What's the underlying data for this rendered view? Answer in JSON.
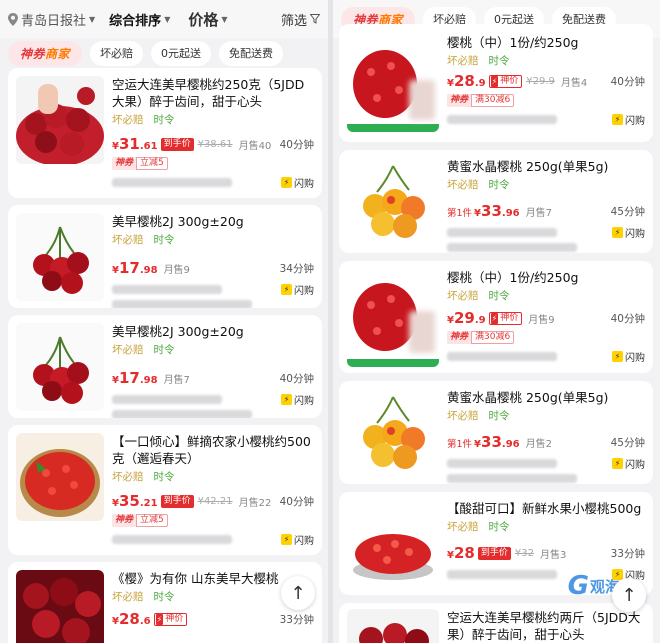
{
  "left_header": {
    "location": "青岛日报社",
    "sort": "综合排序",
    "price": "价格",
    "filter": "筛选"
  },
  "chips": {
    "brand_a": "神券",
    "brand_b": "商家",
    "no_bad": "坏必赔",
    "zero_start": "0元起送",
    "free_delivery": "免配送费"
  },
  "left_cards": [
    {
      "title": "空运大连美早樱桃约250克（5JDD大果）醉于齿间，甜于心头",
      "tag1": "坏必赔",
      "tag2": "时令",
      "price_int": "31",
      "price_dec": ".61",
      "badge": "到手价",
      "orig": "¥38.61",
      "sold": "月售40",
      "eta": "40分钟",
      "promo1": "神券",
      "promo2": "立减5",
      "flash": "闪购"
    },
    {
      "title": "美早樱桃2J 300g±20g",
      "tag1": "坏必赔",
      "tag2": "时令",
      "price_int": "17",
      "price_dec": ".98",
      "sold": "月售9",
      "eta": "34分钟",
      "flash": "闪购"
    },
    {
      "title": "美早樱桃2J 300g±20g",
      "tag1": "坏必赔",
      "tag2": "时令",
      "price_int": "17",
      "price_dec": ".98",
      "sold": "月售7",
      "eta": "40分钟",
      "flash": "闪购"
    },
    {
      "title": "【一口倾心】鲜摘农家小樱桃约500克（邂逅春天）",
      "tag1": "坏必赔",
      "tag2": "时令",
      "price_int": "35",
      "price_dec": ".21",
      "badge": "到手价",
      "orig": "¥42.21",
      "sold": "月售22",
      "eta": "40分钟",
      "promo1": "神券",
      "promo2": "立减5",
      "flash": "闪购"
    },
    {
      "title": "《樱》为有你 山东美早大樱桃",
      "tag1": "坏必赔",
      "tag2": "时令",
      "price_int": "28",
      "price_dec": ".6",
      "badge": "神价",
      "eta": "33分钟"
    }
  ],
  "right_cards": [
    {
      "title": "樱桃（中）1份/约250g",
      "tag1": "坏必赔",
      "tag2": "时令",
      "price_int": "28",
      "price_dec": ".9",
      "badge": "神价",
      "orig": "¥29.9",
      "sold": "月售4",
      "eta": "40分钟",
      "promo1": "神券",
      "promo2": "满30减6",
      "flash": "闪购"
    },
    {
      "title": "黄蜜水晶樱桃 250g(单果5g)",
      "tag1": "坏必赔",
      "tag2": "时令",
      "first": "第1件",
      "price_int": "33",
      "price_dec": ".96",
      "sold": "月售7",
      "eta": "45分钟",
      "flash": "闪购"
    },
    {
      "title": "樱桃（中）1份/约250g",
      "tag1": "坏必赔",
      "tag2": "时令",
      "price_int": "29",
      "price_dec": ".9",
      "badge": "神价",
      "sold": "月售9",
      "eta": "40分钟",
      "promo1": "神券",
      "promo2": "满30减6",
      "flash": "闪购"
    },
    {
      "title": "黄蜜水晶樱桃 250g(单果5g)",
      "tag1": "坏必赔",
      "tag2": "时令",
      "first": "第1件",
      "price_int": "33",
      "price_dec": ".96",
      "sold": "月售2",
      "eta": "45分钟",
      "flash": "闪购"
    },
    {
      "title": "【酸甜可口】新鲜水果小樱桃500g",
      "tag1": "坏必赔",
      "tag2": "时令",
      "price_int": "28",
      "price_dec": "",
      "badge": "到手价",
      "orig": "¥32",
      "sold": "月售3",
      "eta": "33分钟",
      "flash": "闪购"
    },
    {
      "title": "空运大连美早樱桃约两斤（5JDD大果）醉于齿间，甜于心头"
    }
  ],
  "currency": "¥",
  "watermark": {
    "g": "G",
    "cn": "观海"
  },
  "back_to_top": "↑",
  "colors": {
    "price_red": "#e42c2c",
    "tag_gold": "#c8a33a",
    "tag_green": "#4ba83c",
    "flash_yellow": "#ffd100"
  }
}
